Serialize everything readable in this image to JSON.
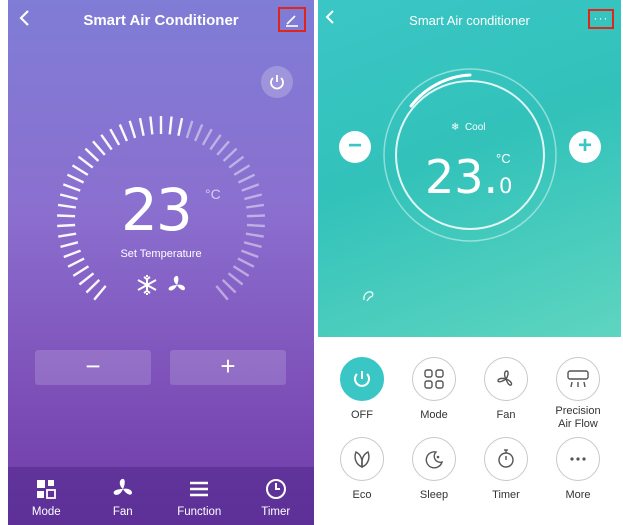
{
  "left": {
    "title": "Smart Air Conditioner",
    "temperature": "23",
    "unit": "°C",
    "temperature_label": "Set Temperature",
    "minus_label": "−",
    "plus_label": "+",
    "tabs": [
      {
        "label": "Mode",
        "icon": "mode-icon"
      },
      {
        "label": "Fan",
        "icon": "fan-icon"
      },
      {
        "label": "Function",
        "icon": "menu-icon"
      },
      {
        "label": "Timer",
        "icon": "clock-icon"
      }
    ],
    "colors": {
      "accent": "#8b6fcf",
      "highlight_box": "#e0251b"
    }
  },
  "right": {
    "title": "Smart Air conditioner",
    "more_label": "···",
    "mode": "Cool",
    "temperature": "23.",
    "temperature_decimal": "0",
    "unit": "°C",
    "minus_label": "−",
    "plus_label": "+",
    "controls": [
      {
        "label": "OFF",
        "icon": "power-icon",
        "active": true
      },
      {
        "label": "Mode",
        "icon": "mode-grid-icon"
      },
      {
        "label": "Fan",
        "icon": "fan-icon"
      },
      {
        "label": "Precision\nAir Flow",
        "line1": "Precision",
        "line2": "Air Flow",
        "icon": "air-flow-icon"
      },
      {
        "label": "Eco",
        "icon": "leaf-icon"
      },
      {
        "label": "Sleep",
        "icon": "moon-icon"
      },
      {
        "label": "Timer",
        "icon": "stopwatch-icon"
      },
      {
        "label": "More",
        "icon": "more-dots-icon"
      }
    ],
    "colors": {
      "accent": "#3bc6c6",
      "highlight_box": "#e0251b"
    }
  }
}
